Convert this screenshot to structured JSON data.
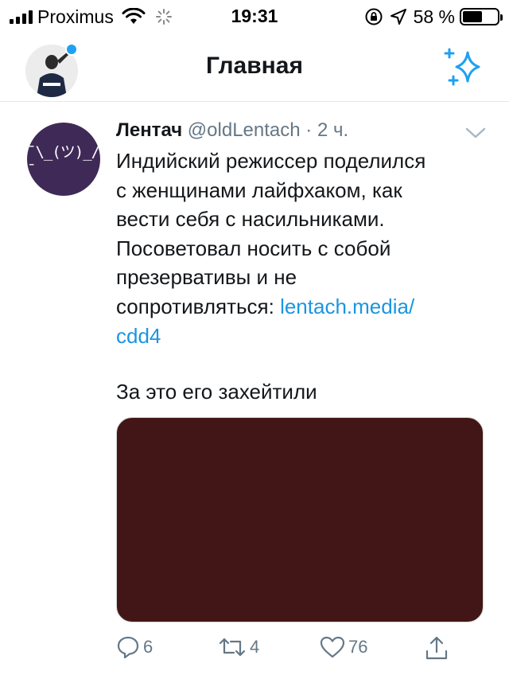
{
  "status_bar": {
    "carrier": "Proximus",
    "time": "19:31",
    "battery_percent": "58 %",
    "battery_level": 0.58
  },
  "header": {
    "title": "Главная"
  },
  "tweet": {
    "author_name": "Лентач",
    "handle": "@oldLentach",
    "separator": "·",
    "time": "2 ч.",
    "avatar_text": "¯\\_(ツ)_/¯",
    "text_lines": [
      "Индийский режиссер поделился",
      "с женщинами лайфхаком, как",
      "вести себя с насильниками.",
      "Посоветовал носить с собой",
      "презервативы и не"
    ],
    "text_last_prefix": "сопротивляться: ",
    "link_part1": "lentach.media/",
    "link_part2": "cdd4",
    "second_paragraph": "За это его захейтили",
    "media_color": "#421616",
    "actions": {
      "reply_count": "6",
      "retweet_count": "4",
      "like_count": "76"
    }
  },
  "colors": {
    "accent": "#1da1f2",
    "link": "#1b95e0",
    "muted": "#657786",
    "avatar_bg": "#3f2a57"
  },
  "icons": [
    "signal-icon",
    "wifi-icon",
    "activity-spinner-icon",
    "rotation-lock-icon",
    "location-arrow-icon",
    "battery-icon",
    "sparkle-icon",
    "chevron-down-icon",
    "reply-icon",
    "retweet-icon",
    "like-icon",
    "share-icon"
  ]
}
